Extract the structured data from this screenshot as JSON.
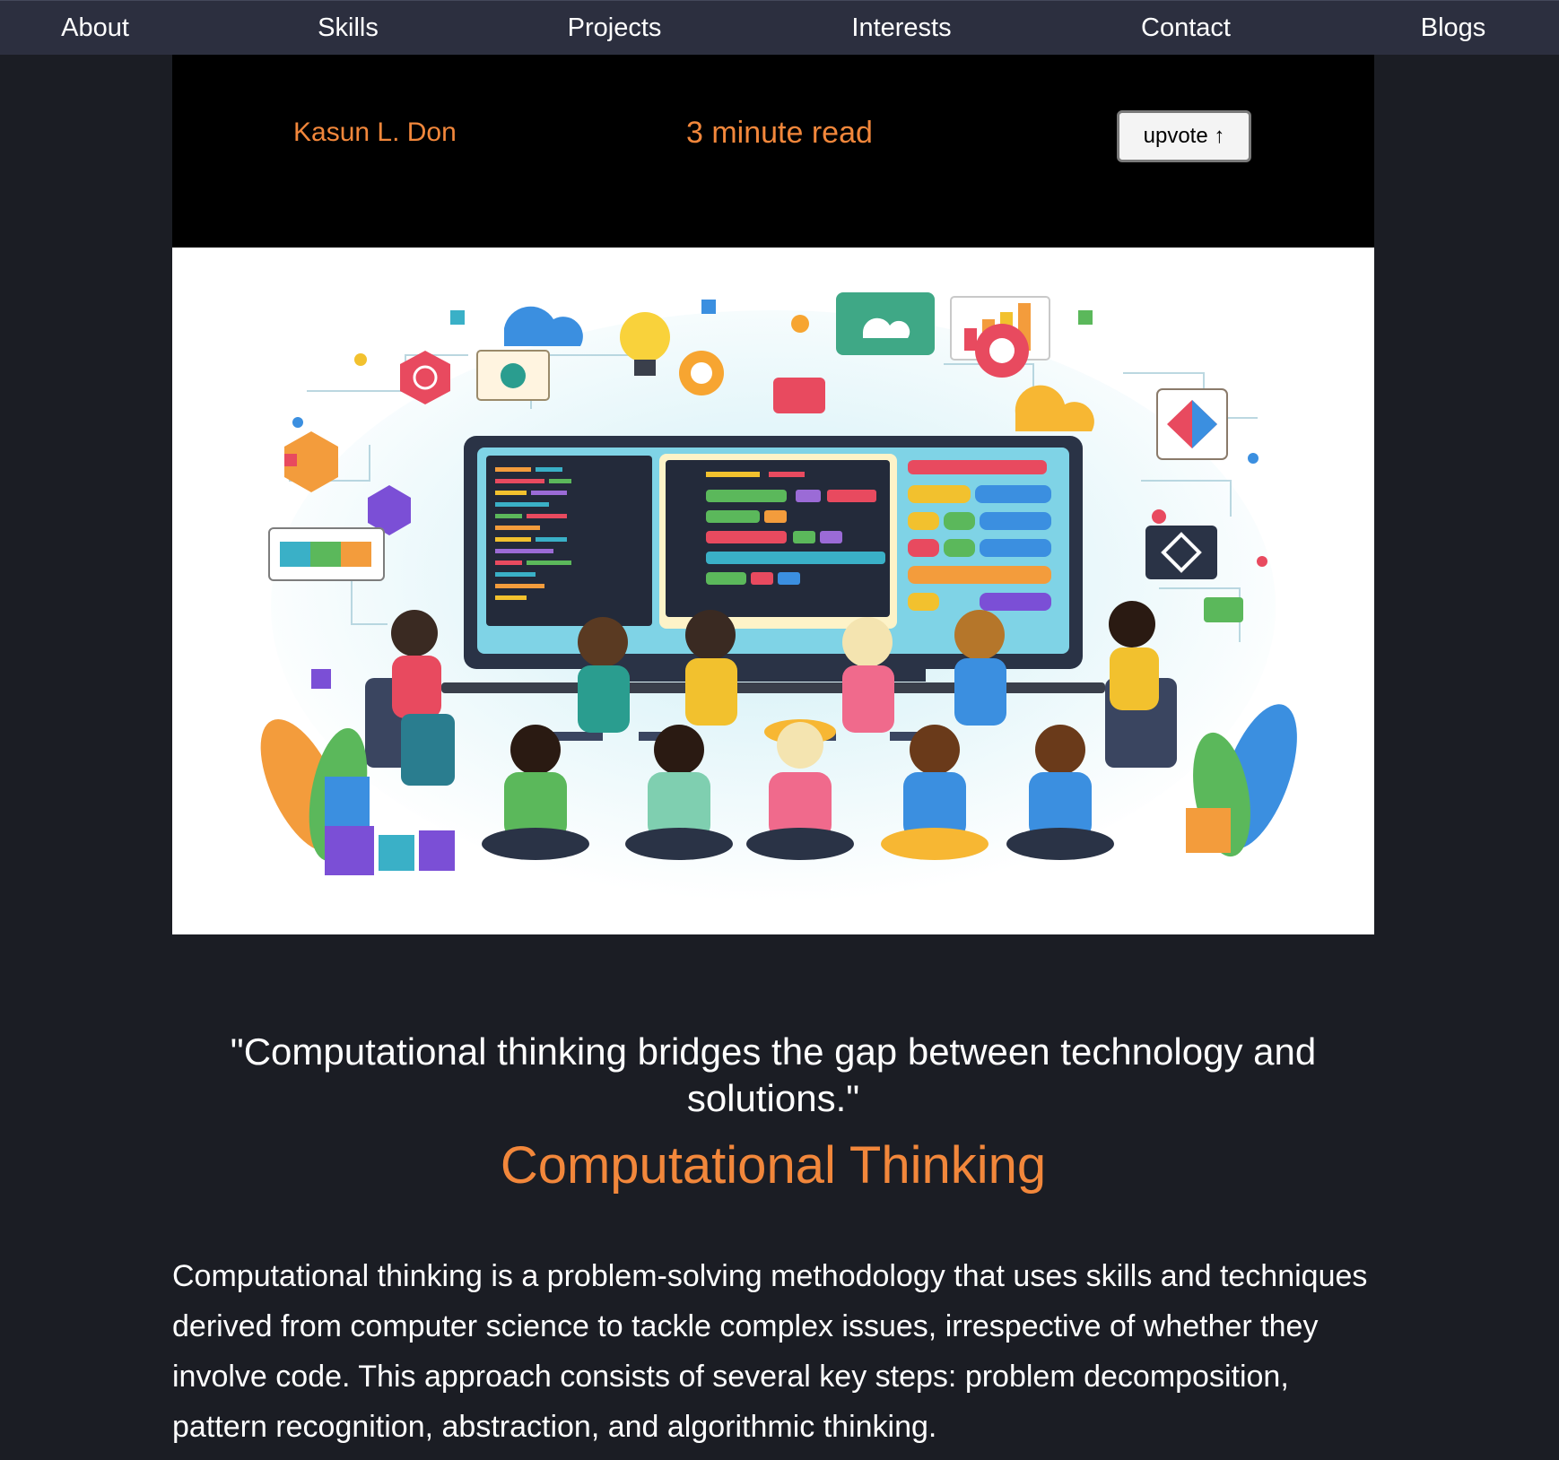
{
  "nav": {
    "items": [
      {
        "label": "About"
      },
      {
        "label": "Skills"
      },
      {
        "label": "Projects"
      },
      {
        "label": "Interests"
      },
      {
        "label": "Contact"
      },
      {
        "label": "Blogs"
      }
    ]
  },
  "post": {
    "author": "Kasun L. Don",
    "read_time": "3 minute read",
    "upvote_label": "upvote ↑"
  },
  "quote": "\"Computational thinking bridges the gap between technology and solutions.\"",
  "section": {
    "heading": "Computational Thinking",
    "paragraph": "Computational thinking is a problem-solving methodology that uses skills and techniques derived from computer science to tackle complex issues, irrespective of whether they involve code. This approach consists of several key steps: problem decomposition, pattern recognition, abstraction, and algorithmic thinking."
  },
  "colors": {
    "page_bg": "#1b1d24",
    "nav_bg": "#2c2f3f",
    "accent": "#f2873b"
  }
}
